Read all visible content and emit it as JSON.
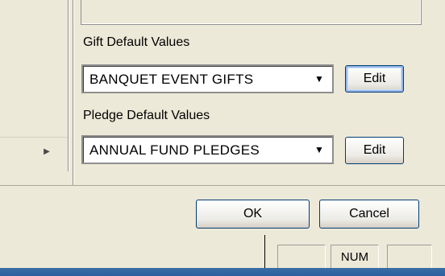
{
  "gift_section": {
    "label": "Gift Default Values",
    "selected_value": "BANQUET EVENT GIFTS",
    "edit_label": "Edit"
  },
  "pledge_section": {
    "label": "Pledge Default Values",
    "selected_value": "ANNUAL FUND PLEDGES",
    "edit_label": "Edit"
  },
  "dialog_buttons": {
    "ok_label": "OK",
    "cancel_label": "Cancel"
  },
  "status_bar": {
    "num_indicator": "NUM"
  },
  "icons": {
    "scroll_right": "right-arrow-icon",
    "dropdown": "chevron-down-icon"
  },
  "colors": {
    "background": "#ece9d8",
    "focus_border": "#98b8ea",
    "taskbar": "#3a6ea5"
  }
}
